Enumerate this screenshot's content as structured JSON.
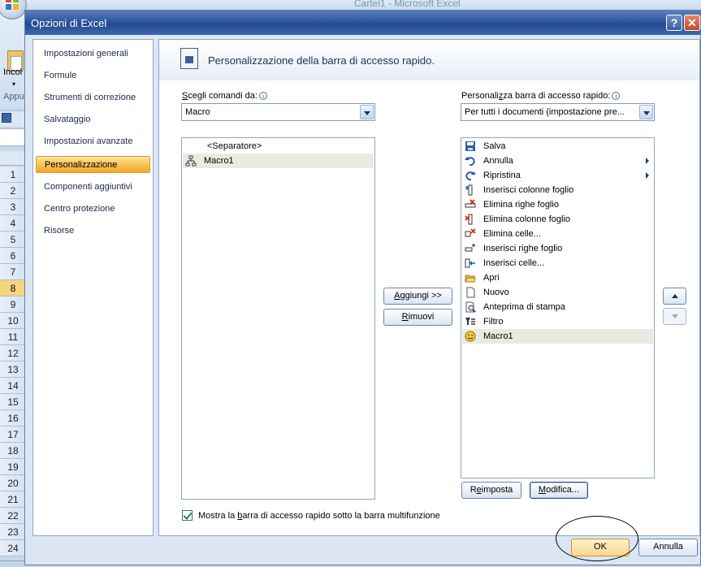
{
  "background": {
    "window_title": "Cartel1 - Microsoft Excel",
    "ribbon_paste_label": "Incol",
    "ribbon_group_label": "Appu",
    "row_numbers": [
      "1",
      "2",
      "3",
      "4",
      "5",
      "6",
      "7",
      "8",
      "9",
      "10",
      "11",
      "12",
      "13",
      "14",
      "15",
      "16",
      "17",
      "18",
      "19",
      "20",
      "21",
      "22",
      "23",
      "24"
    ],
    "selected_row": "8"
  },
  "dialog": {
    "title": "Opzioni di Excel",
    "help_glyph": "?",
    "close_glyph": "✕",
    "nav": [
      {
        "label": "Impostazioni generali"
      },
      {
        "label": "Formule"
      },
      {
        "label": "Strumenti di correzione"
      },
      {
        "label": "Salvataggio"
      },
      {
        "label": "Impostazioni avanzate"
      },
      {
        "label": "Personalizzazione",
        "active": true
      },
      {
        "label": "Componenti aggiuntivi"
      },
      {
        "label": "Centro protezione"
      },
      {
        "label": "Risorse"
      }
    ],
    "header": "Personalizzazione della barra di accesso rapido.",
    "left": {
      "label_pre": "",
      "label_u": "S",
      "label_post": "cegli comandi da:",
      "combo_value": "Macro",
      "items": [
        {
          "label": "<Separatore>",
          "icon": "none-icon"
        },
        {
          "label": "Macro1",
          "icon": "macro-icon",
          "selected": true
        }
      ]
    },
    "right": {
      "label_pre": "Personali",
      "label_u": "z",
      "label_post": "za barra di accesso rapido:",
      "combo_value": "Per tutti i documenti (impostazione pre...",
      "items": [
        {
          "label": "Salva",
          "icon": "save-icon"
        },
        {
          "label": "Annulla",
          "icon": "undo-icon",
          "submenu": true
        },
        {
          "label": "Ripristina",
          "icon": "redo-icon",
          "submenu": true
        },
        {
          "label": "Inserisci colonne foglio",
          "icon": "insert-columns-icon"
        },
        {
          "label": "Elimina righe foglio",
          "icon": "delete-rows-icon"
        },
        {
          "label": "Elimina colonne foglio",
          "icon": "delete-columns-icon"
        },
        {
          "label": "Elimina celle...",
          "icon": "delete-cells-icon"
        },
        {
          "label": "Inserisci righe foglio",
          "icon": "insert-rows-icon"
        },
        {
          "label": "Inserisci celle...",
          "icon": "insert-cells-icon"
        },
        {
          "label": "Apri",
          "icon": "open-folder-icon"
        },
        {
          "label": "Nuovo",
          "icon": "new-document-icon"
        },
        {
          "label": "Anteprima di stampa",
          "icon": "print-preview-icon"
        },
        {
          "label": "Filtro",
          "icon": "filter-icon"
        },
        {
          "label": "Macro1",
          "icon": "smiley-icon",
          "selected": true
        }
      ]
    },
    "buttons": {
      "add_pre": "",
      "add_u": "A",
      "add_post": "ggiungi >>",
      "remove_pre": "",
      "remove_u": "R",
      "remove_post": "imuovi",
      "reset_pre": "R",
      "reset_u": "e",
      "reset_post": "imposta",
      "modify_pre": "",
      "modify_u": "M",
      "modify_post": "odifica...",
      "ok": "OK",
      "cancel": "Annulla"
    },
    "checkbox": {
      "checked": true,
      "label_pre": "Mostra la ",
      "label_u": "b",
      "label_post": "arra di accesso rapido sotto la barra multifunzione"
    }
  }
}
